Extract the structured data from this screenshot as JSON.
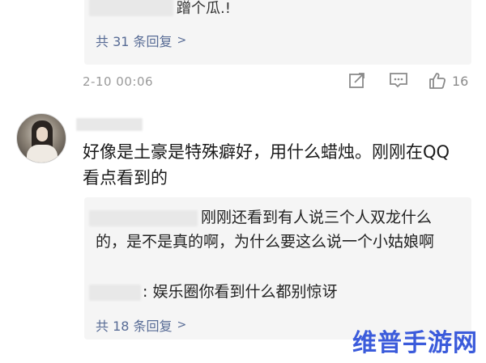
{
  "reply_top": {
    "text": "蹭个瓜.!",
    "count_label": "共 31 条回复"
  },
  "meta": {
    "timestamp": "2-10 00:06",
    "likes": "16",
    "icons": [
      "share-icon",
      "comment-icon",
      "thumbs-up-icon"
    ]
  },
  "comment": {
    "text": "好像是土豪是特殊癖好，用什么蜡烛。刚刚在QQ看点看到的",
    "replies": [
      {
        "text": "刚刚还看到有人说三个人双龙什么的，是不是真的啊，为什么要这么说一个小姑娘啊"
      },
      {
        "text": ": 娱乐圈你看到什么都别惊讶"
      }
    ],
    "count_label": "共 18 条回复"
  },
  "watermark": "维普手游网",
  "colors": {
    "link": "#576b95",
    "reply_bg": "#f5f5f5",
    "muted": "#9a9a9a",
    "watermark": "#3b5bdb"
  }
}
